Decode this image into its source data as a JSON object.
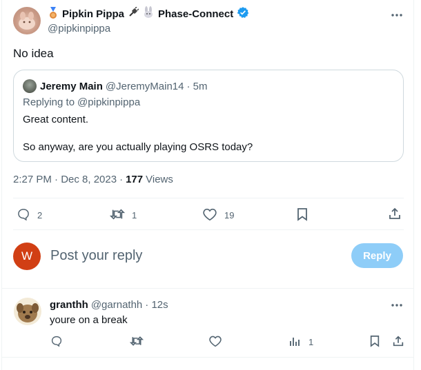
{
  "tweet": {
    "author_name": "Pipkin Pippa",
    "author_suffix": "Phase-Connect",
    "author_handle": "@pipkinpippa",
    "text": "No idea",
    "timestamp": "2:27 PM · Dec 8, 2023",
    "views_count": "177",
    "views_label": "Views",
    "actions": {
      "replies": "2",
      "retweets": "1",
      "likes": "19"
    }
  },
  "quote": {
    "author_name": "Jeremy Main",
    "author_handle": "@JeremyMain14",
    "time": "· 5m",
    "replying_prefix": "Replying to",
    "replying_to": "@pipkinpippa",
    "line1": "Great content.",
    "line2": "So anyway, are you actually playing OSRS today?"
  },
  "composer": {
    "avatar_letter": "W",
    "placeholder": "Post your reply",
    "button": "Reply"
  },
  "reply": {
    "author_name": "granthh",
    "author_handle": "@garnathh",
    "time": "· 12s",
    "text": "youre on a break",
    "views": "1"
  },
  "colors": {
    "accent": "#1d9bf0",
    "reply_button": "#8ecdf8",
    "composer_avatar": "#d13f14",
    "text": "#0f1419",
    "muted": "#536471"
  }
}
